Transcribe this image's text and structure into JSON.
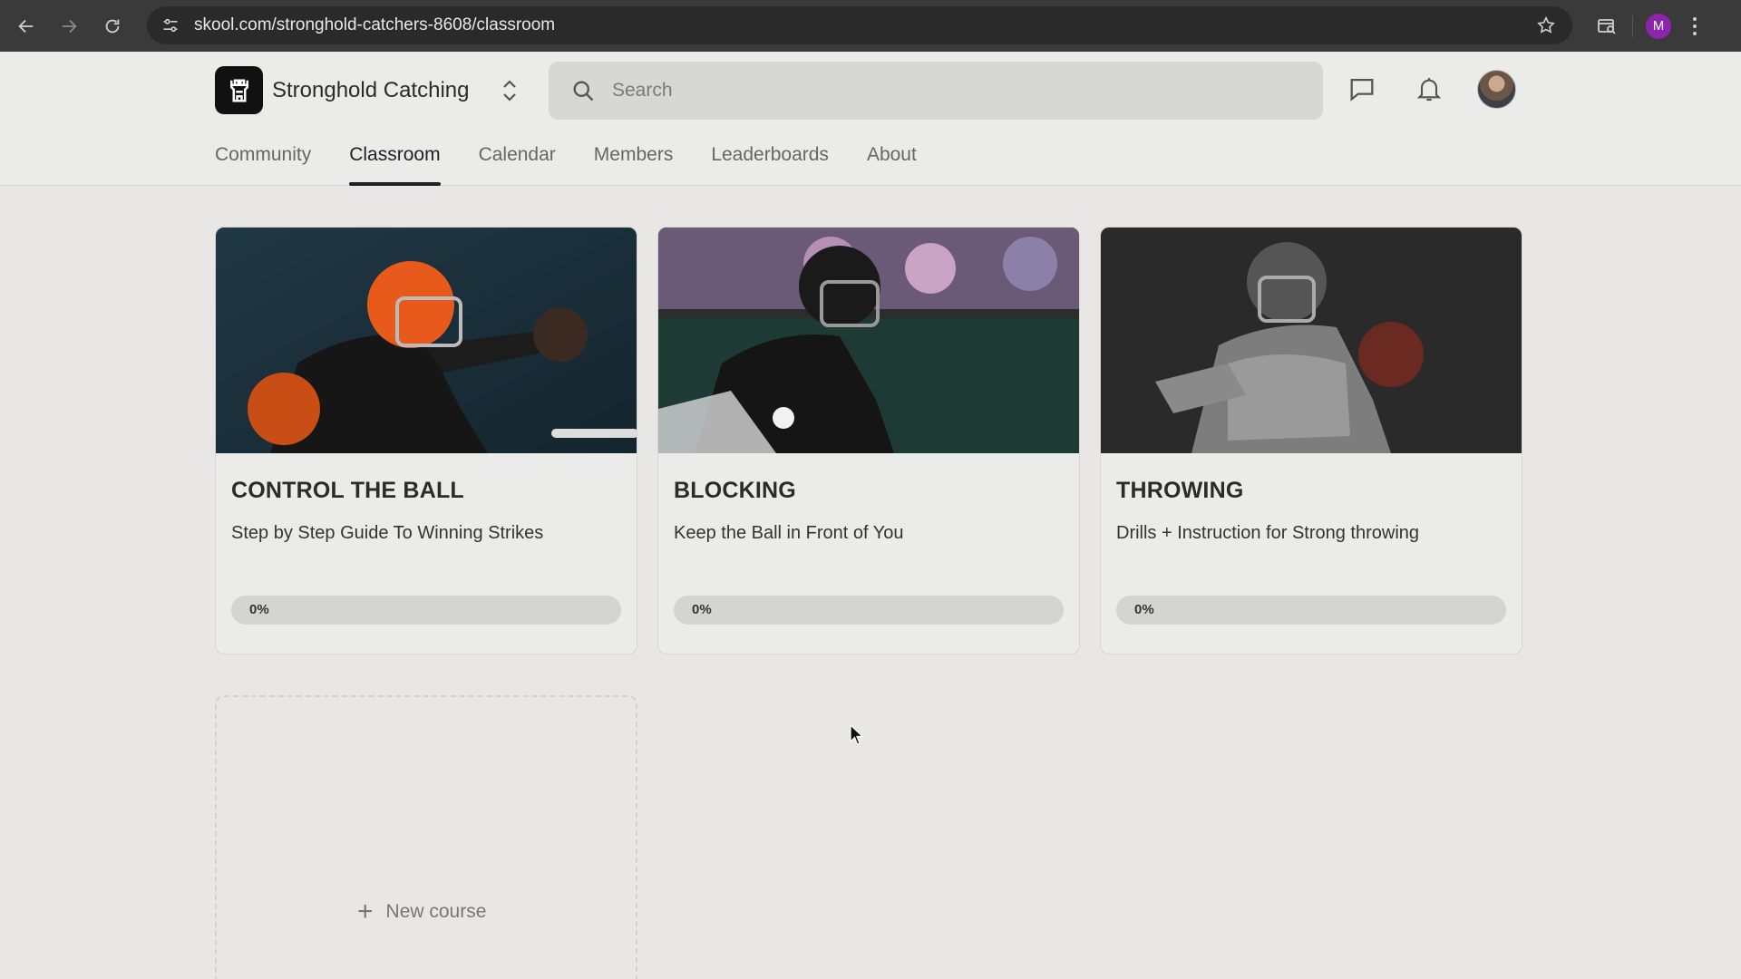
{
  "browser": {
    "url": "skool.com/stronghold-catchers-8608/classroom",
    "profile_initial": "M"
  },
  "header": {
    "group_name": "Stronghold Catching",
    "search_placeholder": "Search"
  },
  "tabs": [
    {
      "label": "Community"
    },
    {
      "label": "Classroom",
      "active": true
    },
    {
      "label": "Calendar"
    },
    {
      "label": "Members"
    },
    {
      "label": "Leaderboards"
    },
    {
      "label": "About"
    }
  ],
  "courses": [
    {
      "title": "CONTROL THE BALL",
      "description": "Step by Step Guide To Winning Strikes",
      "progress_label": "0%",
      "progress": 0
    },
    {
      "title": "BLOCKING",
      "description": "Keep the Ball in Front of You",
      "progress_label": "0%",
      "progress": 0
    },
    {
      "title": "THROWING",
      "description": "Drills + Instruction for Strong throwing",
      "progress_label": "0%",
      "progress": 0
    }
  ],
  "new_course": {
    "label": "New course"
  },
  "icons": {
    "back": "arrow-left-icon",
    "forward": "arrow-right-icon",
    "reload": "reload-icon",
    "site_settings": "tune-icon",
    "bookmark": "star-icon",
    "search": "search-icon",
    "chat": "chat-icon",
    "notifications": "bell-icon",
    "switcher": "chevron-updown-icon",
    "logo": "castle-icon"
  }
}
